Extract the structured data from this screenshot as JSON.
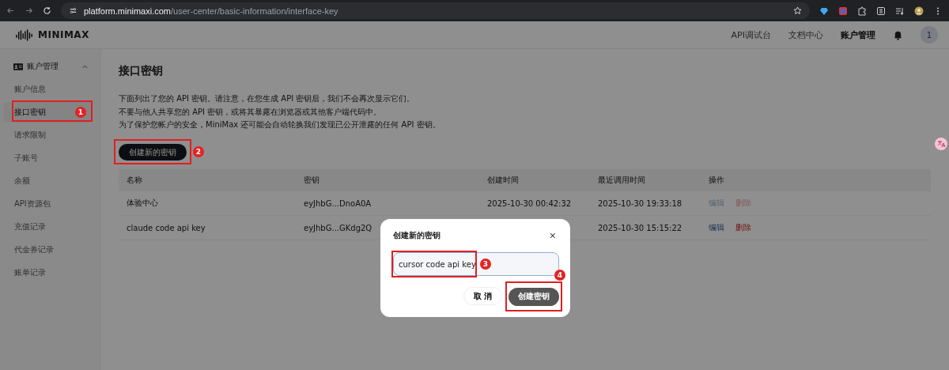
{
  "browser": {
    "url_host": "platform.minimaxi.com",
    "url_path": "/user-center/basic-information/interface-key"
  },
  "header": {
    "logo_text": "MINIMAX",
    "nav": [
      {
        "label": "API调试台",
        "selected": false
      },
      {
        "label": "文档中心",
        "selected": false
      },
      {
        "label": "账户管理",
        "selected": true
      }
    ],
    "avatar": "1"
  },
  "sidebar": {
    "group": {
      "label": "账户管理",
      "expanded": true
    },
    "items": [
      {
        "label": "账户信息",
        "selected": false
      },
      {
        "label": "接口密钥",
        "selected": true,
        "annotation": "1"
      },
      {
        "label": "请求限制",
        "selected": false
      },
      {
        "label": "子账号",
        "selected": false
      },
      {
        "label": "余额",
        "selected": false
      },
      {
        "label": "API资源包",
        "selected": false
      },
      {
        "label": "充值记录",
        "selected": false
      },
      {
        "label": "代金券记录",
        "selected": false
      },
      {
        "label": "账单记录",
        "selected": false
      }
    ]
  },
  "page": {
    "title": "接口密钥",
    "notes": [
      "下面列出了您的 API 密钥。请注意，在您生成 API 密钥后，我们不会再次显示它们。",
      "不要与他人共享您的 API 密钥，或将其暴露在浏览器或其他客户端代码中。",
      "为了保护您帐户的安全，MiniMax 还可能会自动轮换我们发现已公开泄露的任何 API 密钥。"
    ],
    "create_button": {
      "label": "创建新的密钥",
      "annotation": "2"
    }
  },
  "table": {
    "columns": [
      "名称",
      "密钥",
      "创建时间",
      "最近调用时间",
      "操作"
    ],
    "rows": [
      {
        "name": "体验中心",
        "key": "eyJhbG...DnoA0A",
        "created": "2025-10-30 00:42:32",
        "last_used": "2025-10-30 19:33:18",
        "edit": "编辑",
        "delete": "删除",
        "disabled": true
      },
      {
        "name": "claude code api key",
        "key": "eyJhbG...GKdg2Q",
        "last_used": "2025-10-30 15:15:22",
        "edit": "编辑",
        "delete": "删除",
        "disabled": false
      }
    ]
  },
  "dialog": {
    "title": "创建新的密钥",
    "close": "×",
    "input": {
      "value": "cursor code api key",
      "annotation": "3"
    },
    "cancel": "取 消",
    "confirm": {
      "label": "创建密钥",
      "annotation": "4"
    }
  }
}
